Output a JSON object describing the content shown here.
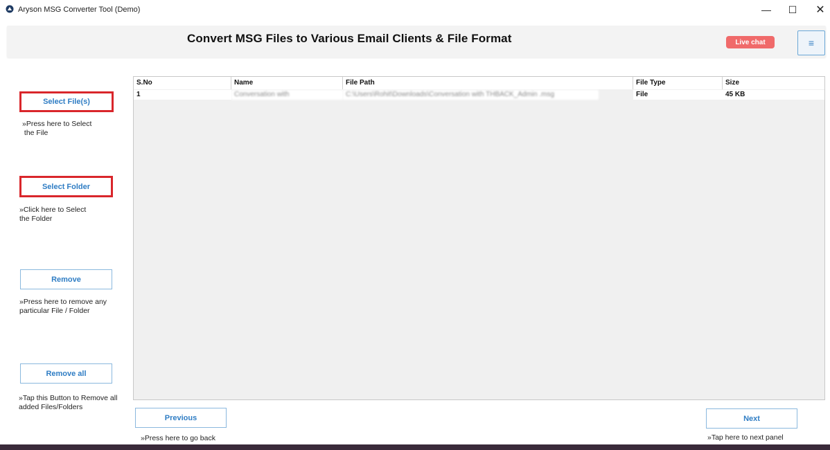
{
  "window": {
    "title": "Aryson MSG Converter Tool (Demo)",
    "minimize": "—",
    "maximize": "☐",
    "close": "✕"
  },
  "header": {
    "title": "Convert MSG Files to Various Email Clients & File Format",
    "live_chat": "Live chat",
    "menu_icon": "≡"
  },
  "sidebar": {
    "select_files": {
      "label": "Select File(s)",
      "hint": "»Press here to Select\n the File"
    },
    "select_folder": {
      "label": "Select Folder",
      "hint": "»Click here to Select\nthe Folder"
    },
    "remove": {
      "label": "Remove",
      "hint": "»Press here to remove any\nparticular File / Folder"
    },
    "remove_all": {
      "label": "Remove all",
      "hint": "»Tap this Button to Remove all\nadded Files/Folders"
    }
  },
  "table": {
    "columns": [
      "S.No",
      "Name",
      "File Path",
      "File Type",
      "Size"
    ],
    "rows": [
      {
        "sno": "1",
        "name": "Conversation with",
        "path": "C:\\Users\\Rohit\\Downloads\\Conversation with THBACK_Admin .msg",
        "type": "File",
        "size": "45 KB"
      }
    ]
  },
  "footer": {
    "previous": {
      "label": "Previous",
      "hint": "»Press here to go back"
    },
    "next": {
      "label": "Next",
      "hint": "»Tap here to next panel"
    }
  },
  "colors": {
    "accent": "#2f7dc4",
    "highlight_border": "#d9262b",
    "live_chat_bg": "#f06a6a"
  }
}
